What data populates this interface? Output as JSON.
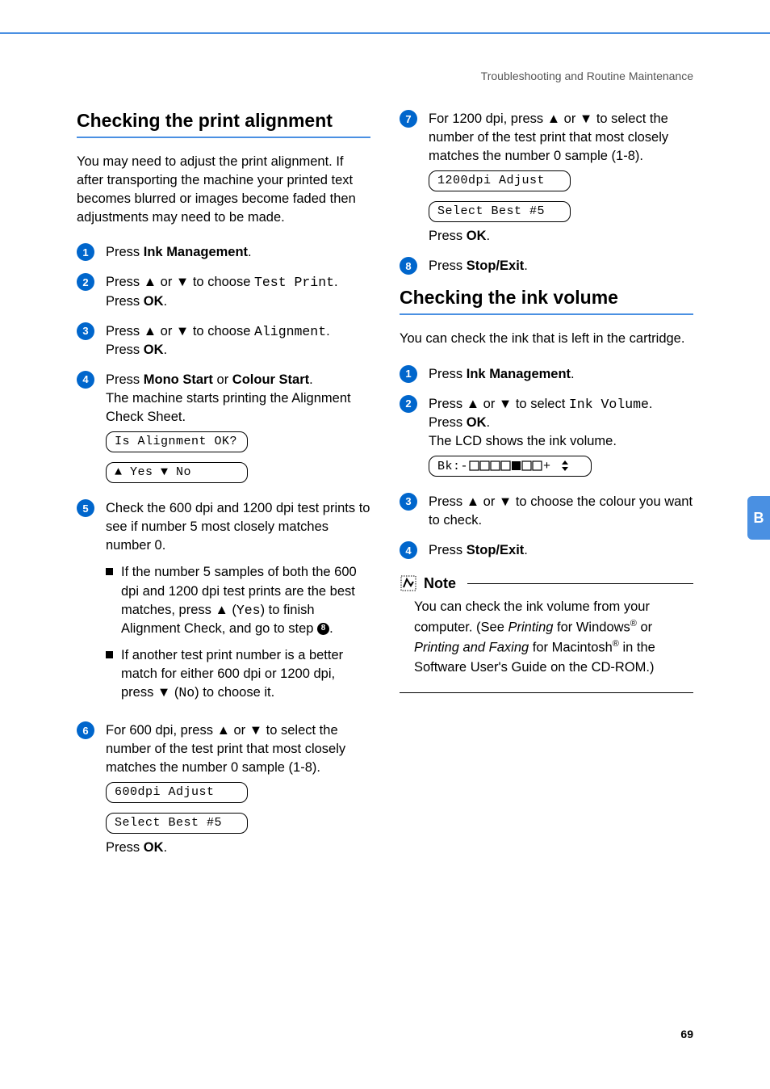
{
  "header": "Troubleshooting and Routine Maintenance",
  "tab": "B",
  "page_number": "69",
  "left": {
    "h2": "Checking the print alignment",
    "intro": "You may need to adjust the print alignment. If after transporting the machine your printed text becomes blurred or images become faded then adjustments may need to be made.",
    "steps": {
      "s1": {
        "pre": "Press ",
        "bold": "Ink Management",
        "post": "."
      },
      "s2": {
        "pre": "Press ▲ or ▼ to choose ",
        "mono": "Test Print",
        "post": ".",
        "line2_pre": "Press ",
        "line2_bold": "OK",
        "line2_post": "."
      },
      "s3": {
        "pre": "Press ▲ or ▼ to choose ",
        "mono": "Alignment",
        "post": ".",
        "line2_pre": "Press ",
        "line2_bold": "OK",
        "line2_post": "."
      },
      "s4": {
        "pre": "Press ",
        "bold1": "Mono Start",
        "mid": " or ",
        "bold2": "Colour Start",
        "post": ".",
        "line2": "The machine starts printing the Alignment Check Sheet.",
        "lcd": "Is Alignment OK?",
        "lcd2": "▲ Yes ▼ No"
      },
      "s5": {
        "text": "Check the 600 dpi and 1200 dpi test prints to see if number 5 most closely matches number 0.",
        "b1_a": "If the number 5 samples of both the 600 dpi and 1200 dpi test prints are the best matches, press ▲ (",
        "b1_mono": "Yes",
        "b1_b": ") to finish Alignment Check, and go to step ",
        "b1_num": "8",
        "b1_c": ".",
        "b2_a": "If another test print number is a better match for either 600 dpi or 1200 dpi, press ▼ (",
        "b2_mono": "No",
        "b2_b": ") to choose it."
      },
      "s6": {
        "text": "For 600 dpi, press ▲ or ▼ to select the number of the test print that most closely matches the number 0 sample (1-8).",
        "lcd1": "600dpi Adjust",
        "lcd2": "Select Best #5",
        "press_pre": "Press ",
        "press_bold": "OK",
        "press_post": "."
      }
    }
  },
  "right": {
    "s7": {
      "text": "For 1200 dpi, press ▲ or ▼ to select the number of the test print that most closely matches the number 0 sample (1-8).",
      "lcd1": "1200dpi Adjust",
      "lcd2": "Select Best #5",
      "press_pre": "Press ",
      "press_bold": "OK",
      "press_post": "."
    },
    "s8": {
      "pre": "Press ",
      "bold": "Stop/Exit",
      "post": "."
    },
    "h2": "Checking the ink volume",
    "intro": "You can check the ink that is left in the cartridge.",
    "steps": {
      "s1": {
        "pre": "Press ",
        "bold": "Ink Management",
        "post": "."
      },
      "s2": {
        "pre": "Press ▲ or ▼ to select ",
        "mono": "Ink Volume",
        "post": ".",
        "line2_pre": "Press ",
        "line2_bold": "OK",
        "line2_post": ".",
        "line3": "The LCD shows the ink volume."
      },
      "s3": {
        "text": "Press ▲ or ▼ to choose the colour you want to check."
      },
      "s4": {
        "pre": "Press ",
        "bold": "Stop/Exit",
        "post": "."
      }
    },
    "note": {
      "label": "Note",
      "a": "You can check the ink volume from your computer. (See ",
      "i1": "Printing",
      "b": " for Windows",
      "sup1": "®",
      "c": " or ",
      "i2": "Printing and Faxing",
      "d": " for Macintosh",
      "sup2": "®",
      "e": " in the Software User's Guide on the CD-ROM.)"
    }
  }
}
